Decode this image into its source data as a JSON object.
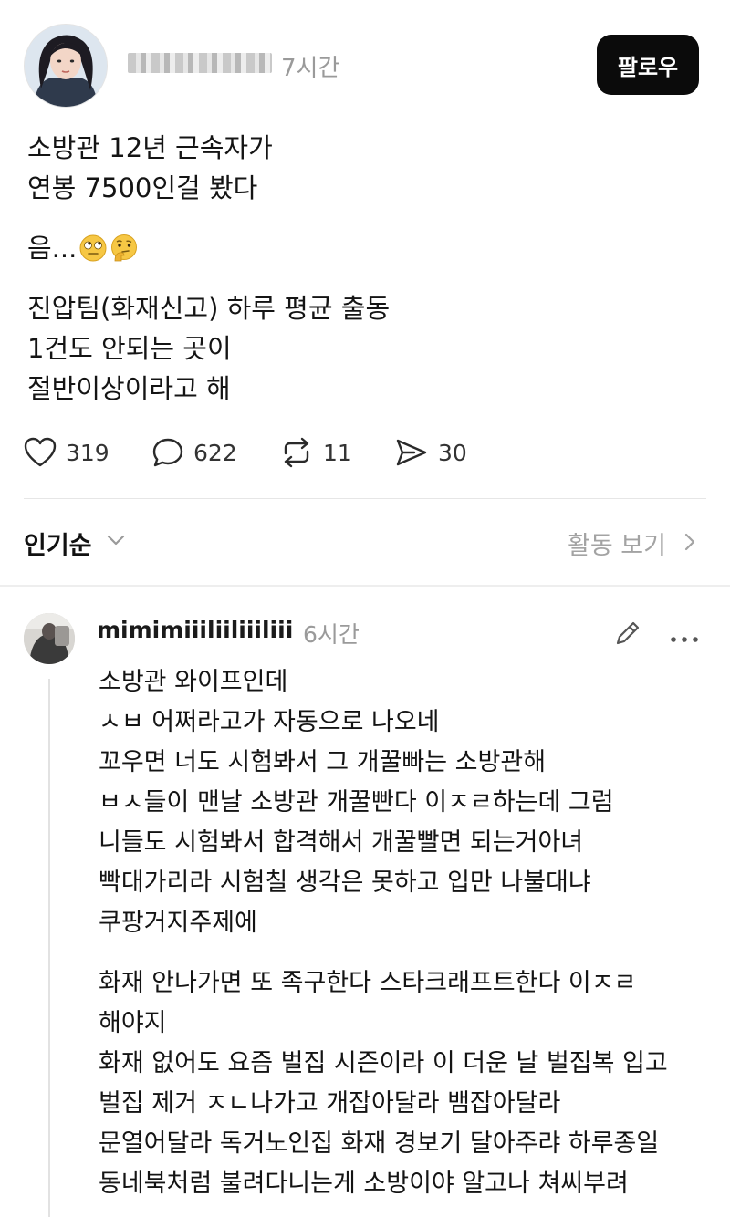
{
  "post": {
    "author_name": "▒▒▒▒▒▒▒▒",
    "time": "7시간",
    "follow_label": "팔로우",
    "lines": [
      "소방관 12년 근속자가",
      "연봉 7500인걸 봤다",
      "음...",
      "진압팀(화재신고) 하루 평균 출동",
      "1건도 안되는 곳이",
      "절반이상이라고 해"
    ],
    "emoji_icons": [
      "face-with-rolling-eyes-icon",
      "thinking-face-icon"
    ],
    "actions": {
      "likes": "319",
      "comments": "622",
      "reposts": "11",
      "shares": "30"
    }
  },
  "sort": {
    "label": "인기순",
    "activity_label": "활동 보기"
  },
  "reply": {
    "username": "mimimiiiliiliiiliii",
    "time": "6시간",
    "lines": [
      "소방관 와이프인데",
      "ㅅㅂ 어쩌라고가 자동으로 나오네",
      "꼬우면 너도 시험봐서 그 개꿀빠는 소방관해",
      "ㅂㅅ들이 맨날 소방관 개꿀빤다 이ㅈㄹ하는데 그럼",
      "니들도 시험봐서 합격해서 개꿀빨면 되는거아녀",
      "빡대가리라 시험칠 생각은 못하고 입만 나불대냐",
      "쿠팡거지주제에",
      "화재 안나가면 또 족구한다 스타크래프트한다 이ㅈㄹ",
      "해야지",
      "화재 없어도 요즘 벌집 시즌이라 이 더운 날 벌집복 입고",
      "벌집 제거 ㅈㄴ나가고 개잡아달라 뱀잡아달라",
      "문열어달라 독거노인집 화재 경보기 달아주랴 하루종일",
      "동네북처럼 불려다니는게 소방이야 알고나 쳐씨부려"
    ]
  },
  "colors": {
    "text": "#111111",
    "muted": "#9a9a9a",
    "follow_bg": "#0b0b0b",
    "divider": "#e6e6e6"
  }
}
